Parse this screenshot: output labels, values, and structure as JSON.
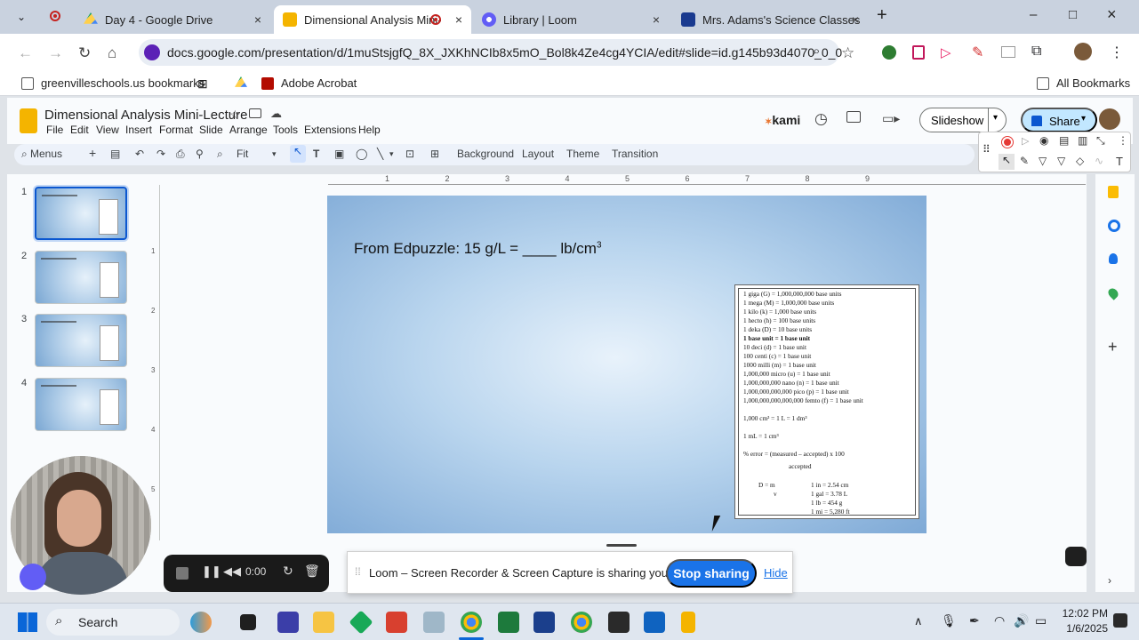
{
  "browser": {
    "tabs": [
      {
        "title": "Day 4 - Google Drive",
        "close": "×"
      },
      {
        "title": "Dimensional Analysis Mini-",
        "close": "×"
      },
      {
        "title": "Library | Loom",
        "close": "×"
      },
      {
        "title": "Mrs. Adams's Science Classes",
        "close": "×"
      }
    ],
    "new_tab": "+",
    "window_controls": {
      "minimize": "–",
      "maximize": "□",
      "close": "×"
    },
    "url": "docs.google.com/presentation/d/1muStsjgfQ_8X_JXKhNCIb8x5mO_Bol8k4Ze4cg4YCIA/edit#slide=id.g145b93d4070_0_0",
    "bookmarks": [
      {
        "label": "greenvilleschools.us bookmarks"
      },
      {
        "label": "Adobe Acrobat"
      }
    ],
    "all_bookmarks": "All Bookmarks"
  },
  "app": {
    "doc_title": "Dimensional Analysis Mini-Lecture",
    "menus": [
      "File",
      "Edit",
      "View",
      "Insert",
      "Format",
      "Slide",
      "Arrange",
      "Tools",
      "Extensions",
      "Help"
    ],
    "kami_label": "kami",
    "slideshow_label": "Slideshow",
    "share_label": "Share",
    "toolbar": {
      "menus_label": "Menus",
      "zoom": "Fit",
      "background": "Background",
      "layout": "Layout",
      "theme": "Theme",
      "transition": "Transition"
    }
  },
  "filmstrip": {
    "slides": [
      {
        "number": "1"
      },
      {
        "number": "2"
      },
      {
        "number": "3"
      },
      {
        "number": "4"
      }
    ]
  },
  "ruler": {
    "top_ticks": [
      "1",
      "2",
      "3",
      "4",
      "5",
      "6",
      "7",
      "8",
      "9"
    ],
    "left_ticks": [
      "1",
      "2",
      "3",
      "4",
      "5"
    ]
  },
  "slide": {
    "title_prefix": "From Edpuzzle:  15 g/L = ____ lb/cm",
    "title_sup": "3",
    "reference_lines": [
      "1 giga (G) = 1,000,000,000 base units",
      "1 mega (M) = 1,000,000 base units",
      "1 kilo (k) = 1,000 base units",
      "1 hecto (h) = 100 base units",
      "1 deka (D) = 10 base units",
      "1 base unit = 1 base unit",
      "10 deci (d) = 1 base unit",
      "100 centi (c) = 1 base unit",
      "1000 milli (m) = 1 base unit",
      "1,000,000 micro (u) = 1 base unit",
      "1,000,000,000 nano (n) = 1 base unit",
      "1,000,000,000,000 pico (p) = 1 base unit",
      "1,000,000,000,000,000 femto (f) = 1 base unit",
      "1,000 cm³ = 1 L = 1 dm³",
      "1 mL = 1 cm³",
      "% error = (measured – accepted)  x  100",
      "accepted",
      "D = m",
      "v",
      "1 in = 2.54 cm",
      "1 gal = 3.78 L",
      "1 lb = 454 g",
      "1 mi = 5,280 ft"
    ]
  },
  "loom": {
    "timer": "0:00",
    "sharing_text": "Loom – Screen Recorder & Screen Capture is sharing your screen.",
    "stop_label": "Stop sharing",
    "hide_label": "Hide"
  },
  "taskbar": {
    "search_label": "Search",
    "time": "12:02 PM",
    "date": "1/6/2025"
  }
}
